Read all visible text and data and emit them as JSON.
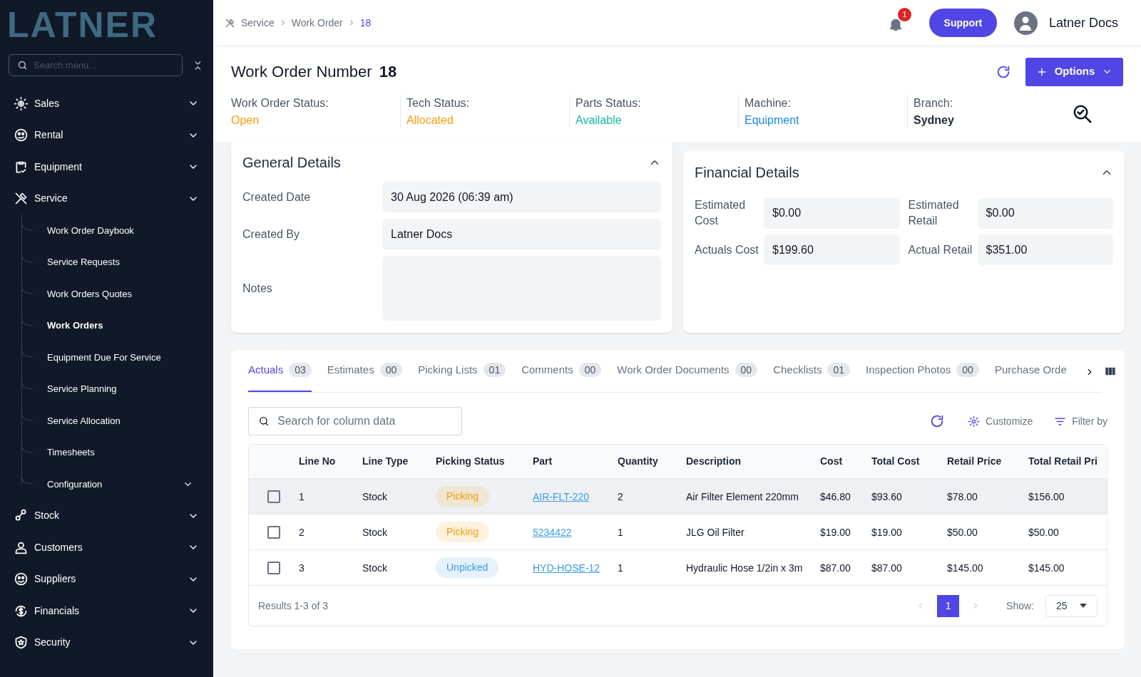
{
  "sidebar": {
    "logo": "LATNER",
    "search": {
      "placeholder": "Search menu..."
    },
    "items": [
      {
        "label": "Sales"
      },
      {
        "label": "Rental"
      },
      {
        "label": "Equipment"
      },
      {
        "label": "Service",
        "children": [
          {
            "label": "Work Order Daybook",
            "selected": false
          },
          {
            "label": "Service Requests",
            "selected": false
          },
          {
            "label": "Work Orders Quotes",
            "selected": false
          },
          {
            "label": "Work Orders",
            "selected": true
          },
          {
            "label": "Equipment Due For Service",
            "selected": false
          },
          {
            "label": "Service Planning",
            "selected": false
          },
          {
            "label": "Service Allocation",
            "selected": false
          },
          {
            "label": "Timesheets",
            "selected": false
          },
          {
            "label": "Configuration",
            "selected": false,
            "has_children": true
          }
        ]
      },
      {
        "label": "Stock"
      },
      {
        "label": "Customers"
      },
      {
        "label": "Suppliers"
      },
      {
        "label": "Financials"
      },
      {
        "label": "Security"
      }
    ]
  },
  "header": {
    "breadcrumb": [
      "Service",
      "Work Order",
      "18"
    ],
    "notifications": "1",
    "support_button": "Support",
    "user": "Latner Docs"
  },
  "work_order": {
    "title": "Work Order Number",
    "number": "18",
    "options_button": "Options",
    "statuses": [
      {
        "label": "Work Order Status:",
        "value": "Open",
        "color": "#f59e0b"
      },
      {
        "label": "Tech Status:",
        "value": "Allocated",
        "color": "#f59e0b"
      },
      {
        "label": "Parts Status:",
        "value": "Available",
        "color": "#14b8a6"
      },
      {
        "label": "Machine:",
        "value": "Equipment",
        "color": "#1e88e5"
      },
      {
        "label": "Branch:",
        "value": "Sydney",
        "color": "#1f2937"
      }
    ]
  },
  "general_details": {
    "title": "General Details",
    "fields": [
      {
        "label": "Created Date",
        "value": "30 Aug 2026 (06:39 am)"
      },
      {
        "label": "Created By",
        "value": "Latner Docs"
      },
      {
        "label": "Notes",
        "kind": "notes"
      }
    ]
  },
  "financial_details": {
    "title": "Financial Details",
    "fields": [
      {
        "label": "Estimated Cost",
        "value": "$0.00"
      },
      {
        "label": "Estimated Retail",
        "value": "$0.00"
      },
      {
        "label": "Actuals Cost",
        "value": "$199.60"
      },
      {
        "label": "Actual Retail",
        "value": "$351.00"
      }
    ]
  },
  "tabs": [
    {
      "label": "Actuals",
      "count": "03",
      "selected": true
    },
    {
      "label": "Estimates",
      "count": "00",
      "selected": false
    },
    {
      "label": "Picking Lists",
      "count": "01",
      "selected": false
    },
    {
      "label": "Comments",
      "count": "00",
      "selected": false
    },
    {
      "label": "Work Order Documents",
      "count": "00",
      "selected": false
    },
    {
      "label": "Checklists",
      "count": "01",
      "selected": false
    },
    {
      "label": "Inspection Photos",
      "count": "00",
      "selected": false
    },
    {
      "label": "Purchase Orde",
      "selected": false
    }
  ],
  "toolbar": {
    "search": {
      "placeholder": "Search for column data"
    },
    "customize": "Customize",
    "filter": "Filter by"
  },
  "table": {
    "columns": [
      "Line No",
      "Line Type",
      "Picking Status",
      "Part",
      "Quantity",
      "Description",
      "Cost",
      "Total Cost",
      "Retail Price",
      "Total Retail Pri"
    ],
    "rows": [
      {
        "checked": false,
        "hovered": true,
        "cells": [
          "1",
          "Stock",
          "Picking",
          "AIR-FLT-220",
          "2",
          "Air Filter Element 220mm",
          "$46.80",
          "$93.60",
          "$78.00",
          "$156.00"
        ],
        "color": "#f59e0b"
      },
      {
        "checked": false,
        "hovered": false,
        "cells": [
          "2",
          "Stock",
          "Picking",
          "5234422",
          "1",
          "JLG Oil Filter",
          "$19.00",
          "$19.00",
          "$50.00",
          "$50.00"
        ],
        "color": "#f59e0b"
      },
      {
        "checked": false,
        "hovered": false,
        "cells": [
          "3",
          "Stock",
          "Unpicked",
          "HYD-HOSE-12",
          "1",
          "Hydraulic Hose 1/2in x 3m",
          "$87.00",
          "$87.00",
          "$145.00",
          "$145.00"
        ],
        "color": "#3b9be5"
      }
    ]
  },
  "footer": {
    "results": "Results 1-3 of 3",
    "pages": [
      {
        "label": "1",
        "selected": true
      }
    ],
    "show_label": "Show:",
    "page_size": "25"
  }
}
